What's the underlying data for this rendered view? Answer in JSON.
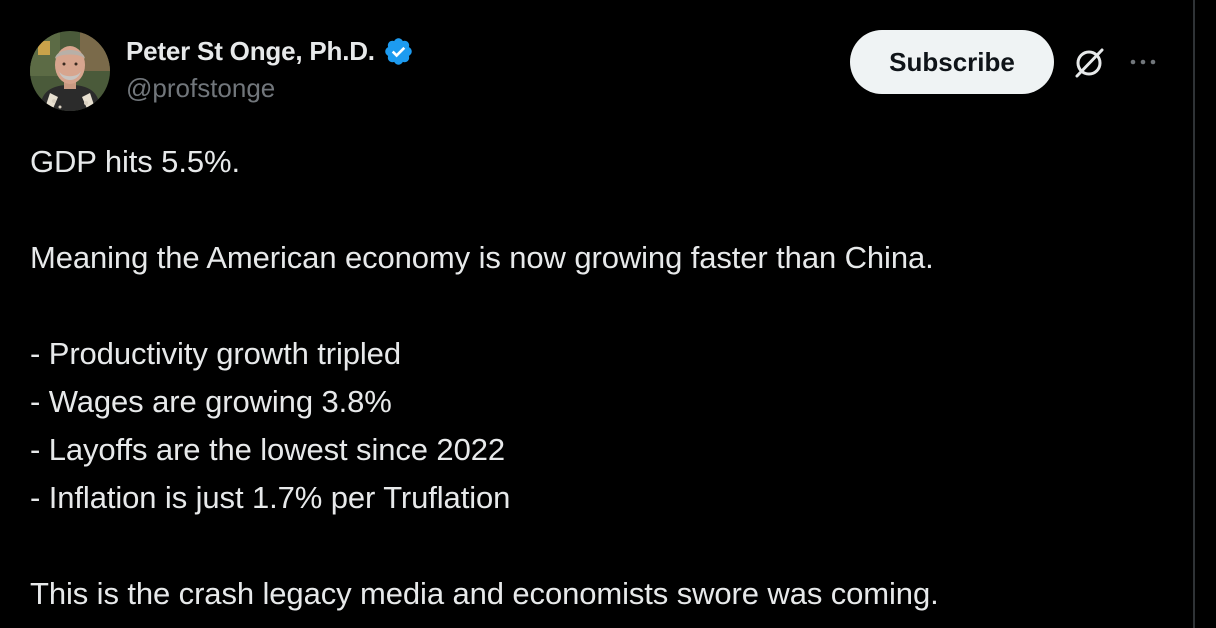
{
  "author": {
    "display_name": "Peter St Onge, Ph.D.",
    "handle": "@profstonge",
    "verified": true
  },
  "header_actions": {
    "subscribe_label": "Subscribe",
    "grok_icon": "grok-slash-circle-icon",
    "more_icon": "more-horizontal-icon"
  },
  "tweet": {
    "line_1": "GDP hits 5.5%.",
    "line_2": "Meaning the American economy is now growing faster than China.",
    "bullets": [
      "- Productivity growth tripled",
      "- Wages are growing 3.8%",
      "- Layoffs are the lowest since 2022",
      "- Inflation is just 1.7% per Truflation"
    ],
    "closing": "This is the crash legacy media and economists swore was coming."
  },
  "colors": {
    "background": "#000000",
    "text_primary": "#e7e9ea",
    "text_secondary": "#71767b",
    "verified_blue": "#1d9bf0",
    "button_bg": "#eff3f4",
    "button_text": "#0f1419"
  }
}
